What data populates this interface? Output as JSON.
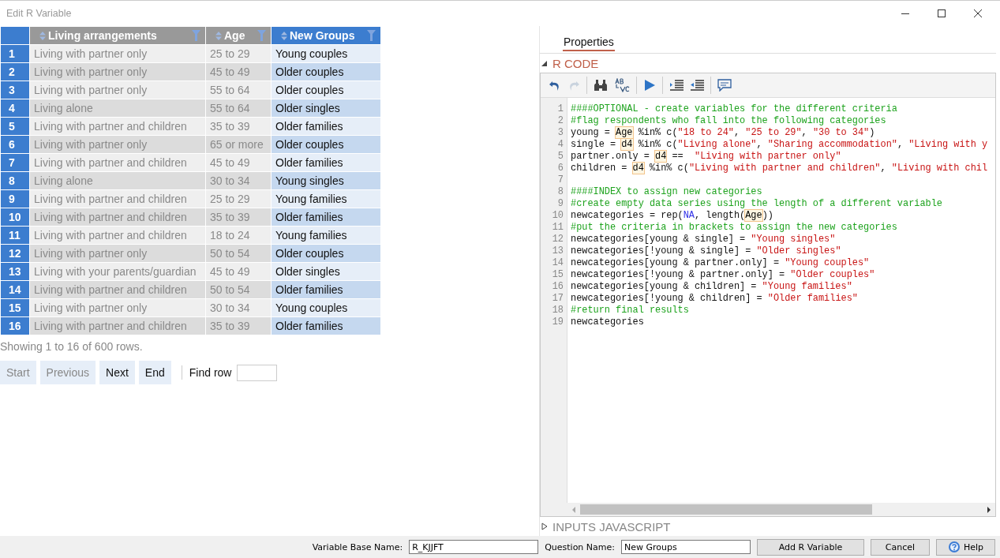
{
  "window": {
    "title": "Edit R Variable"
  },
  "table": {
    "columns": [
      {
        "label": "Living arrangements",
        "kind": "source"
      },
      {
        "label": "Age",
        "kind": "source"
      },
      {
        "label": "New Groups",
        "kind": "result"
      }
    ],
    "rows": [
      {
        "number": "1",
        "cells": [
          "Living with partner only",
          "25 to 29",
          "Young couples"
        ]
      },
      {
        "number": "2",
        "cells": [
          "Living with partner only",
          "45 to 49",
          "Older couples"
        ]
      },
      {
        "number": "3",
        "cells": [
          "Living with partner only",
          "55 to 64",
          "Older couples"
        ]
      },
      {
        "number": "4",
        "cells": [
          "Living alone",
          "55 to 64",
          "Older singles"
        ]
      },
      {
        "number": "5",
        "cells": [
          "Living with partner and children",
          "35 to 39",
          "Older families"
        ]
      },
      {
        "number": "6",
        "cells": [
          "Living with partner only",
          "65 or more",
          "Older couples"
        ]
      },
      {
        "number": "7",
        "cells": [
          "Living with partner and children",
          "45 to 49",
          "Older families"
        ]
      },
      {
        "number": "8",
        "cells": [
          "Living alone",
          "30 to 34",
          "Young singles"
        ]
      },
      {
        "number": "9",
        "cells": [
          "Living with partner and children",
          "25 to 29",
          "Young families"
        ]
      },
      {
        "number": "10",
        "cells": [
          "Living with partner and children",
          "35 to 39",
          "Older families"
        ]
      },
      {
        "number": "11",
        "cells": [
          "Living with partner and children",
          "18 to 24",
          "Young families"
        ]
      },
      {
        "number": "12",
        "cells": [
          "Living with partner only",
          "50 to 54",
          "Older couples"
        ]
      },
      {
        "number": "13",
        "cells": [
          "Living with your parents/guardian",
          "45 to 49",
          "Older singles"
        ]
      },
      {
        "number": "14",
        "cells": [
          "Living with partner and children",
          "50 to 54",
          "Older families"
        ]
      },
      {
        "number": "15",
        "cells": [
          "Living with partner only",
          "30 to 34",
          "Young couples"
        ]
      },
      {
        "number": "16",
        "cells": [
          "Living with partner and children",
          "35 to 39",
          "Older families"
        ]
      }
    ],
    "summary": "Showing 1 to 16 of 600 rows."
  },
  "pager": {
    "buttons": [
      {
        "label": "Start",
        "disabled": true
      },
      {
        "label": "Previous",
        "disabled": true
      },
      {
        "label": "Next",
        "disabled": false
      },
      {
        "label": "End",
        "disabled": false
      }
    ],
    "find_label": "Find row"
  },
  "properties": {
    "tab": "Properties",
    "sections": [
      {
        "title": "R CODE",
        "expanded": true
      },
      {
        "title": "INPUTS JAVASCRIPT",
        "expanded": false
      }
    ],
    "toolbar": [
      {
        "kind": "undo",
        "disabled": false
      },
      {
        "kind": "redo",
        "disabled": true
      },
      {
        "kind": "find",
        "disabled": false
      },
      {
        "kind": "replace",
        "disabled": false
      },
      {
        "kind": "run",
        "disabled": false
      },
      {
        "kind": "indent",
        "disabled": false
      },
      {
        "kind": "outdent",
        "disabled": false
      },
      {
        "kind": "comment",
        "disabled": false
      }
    ],
    "code": [
      {
        "number": "1",
        "tokens": [
          {
            "kind": "comment",
            "text": "####OPTIONAL - create variables for the different criteria"
          }
        ]
      },
      {
        "number": "2",
        "tokens": [
          {
            "kind": "comment",
            "text": "#flag respondents who fall into the following categories"
          }
        ]
      },
      {
        "number": "3",
        "tokens": [
          {
            "kind": "plain",
            "text": "young = "
          },
          {
            "kind": "variable",
            "text": "Age"
          },
          {
            "kind": "plain",
            "text": " %in% c("
          },
          {
            "kind": "string",
            "text": "\"18 to 24\""
          },
          {
            "kind": "plain",
            "text": ", "
          },
          {
            "kind": "string",
            "text": "\"25 to 29\""
          },
          {
            "kind": "plain",
            "text": ", "
          },
          {
            "kind": "string",
            "text": "\"30 to 34\""
          },
          {
            "kind": "plain",
            "text": ")"
          }
        ]
      },
      {
        "number": "4",
        "tokens": [
          {
            "kind": "plain",
            "text": "single = "
          },
          {
            "kind": "variable",
            "text": "d4"
          },
          {
            "kind": "plain",
            "text": " %in% c("
          },
          {
            "kind": "string",
            "text": "\"Living alone\""
          },
          {
            "kind": "plain",
            "text": ", "
          },
          {
            "kind": "string",
            "text": "\"Sharing accommodation\""
          },
          {
            "kind": "plain",
            "text": ", "
          },
          {
            "kind": "string",
            "text": "\"Living with y"
          }
        ]
      },
      {
        "number": "5",
        "tokens": [
          {
            "kind": "plain",
            "text": "partner.only = "
          },
          {
            "kind": "variable",
            "text": "d4"
          },
          {
            "kind": "plain",
            "text": " ==  "
          },
          {
            "kind": "string",
            "text": "\"Living with partner only\""
          }
        ]
      },
      {
        "number": "6",
        "tokens": [
          {
            "kind": "plain",
            "text": "children = "
          },
          {
            "kind": "variable",
            "text": "d4"
          },
          {
            "kind": "plain",
            "text": " %in% c("
          },
          {
            "kind": "string",
            "text": "\"Living with partner and children\""
          },
          {
            "kind": "plain",
            "text": ", "
          },
          {
            "kind": "string",
            "text": "\"Living with chil"
          }
        ]
      },
      {
        "number": "7"
      },
      {
        "number": "8",
        "tokens": [
          {
            "kind": "comment",
            "text": "####INDEX to assign new categories"
          }
        ]
      },
      {
        "number": "9",
        "tokens": [
          {
            "kind": "comment",
            "text": "#create empty data series using the length of a different variable"
          }
        ]
      },
      {
        "number": "10",
        "tokens": [
          {
            "kind": "plain",
            "text": "newcategories = rep("
          },
          {
            "kind": "keyword",
            "text": "NA"
          },
          {
            "kind": "plain",
            "text": ", length("
          },
          {
            "kind": "variable",
            "text": "Age"
          },
          {
            "kind": "plain",
            "text": "))"
          }
        ]
      },
      {
        "number": "11",
        "tokens": [
          {
            "kind": "comment",
            "text": "#put the criteria in brackets to assign the new categories"
          }
        ]
      },
      {
        "number": "12",
        "tokens": [
          {
            "kind": "plain",
            "text": "newcategories[young & single] = "
          },
          {
            "kind": "string",
            "text": "\"Young singles\""
          }
        ]
      },
      {
        "number": "13",
        "tokens": [
          {
            "kind": "plain",
            "text": "newcategories[!young & single] = "
          },
          {
            "kind": "string",
            "text": "\"Older singles\""
          }
        ]
      },
      {
        "number": "14",
        "tokens": [
          {
            "kind": "plain",
            "text": "newcategories[young & partner.only] = "
          },
          {
            "kind": "string",
            "text": "\"Young couples\""
          }
        ]
      },
      {
        "number": "15",
        "tokens": [
          {
            "kind": "plain",
            "text": "newcategories[!young & partner.only] = "
          },
          {
            "kind": "string",
            "text": "\"Older couples\""
          }
        ]
      },
      {
        "number": "16",
        "tokens": [
          {
            "kind": "plain",
            "text": "newcategories[young & children] = "
          },
          {
            "kind": "string",
            "text": "\"Young families\""
          }
        ]
      },
      {
        "number": "17",
        "tokens": [
          {
            "kind": "plain",
            "text": "newcategories[!young & children] = "
          },
          {
            "kind": "string",
            "text": "\"Older families\""
          }
        ]
      },
      {
        "number": "18",
        "tokens": [
          {
            "kind": "comment",
            "text": "#return final results"
          }
        ]
      },
      {
        "number": "19",
        "tokens": [
          {
            "kind": "plain",
            "text": "newcategories"
          }
        ]
      }
    ]
  },
  "footer": {
    "base_name_label": "Variable Base Name:",
    "base_name_value": "R_KJJFT",
    "question_label": "Question Name:",
    "question_value": "New Groups",
    "buttons": [
      {
        "label": "Add R Variable",
        "kind": "text"
      },
      {
        "label": "Cancel",
        "kind": "text"
      },
      {
        "label": "Help",
        "kind": "help"
      }
    ]
  }
}
